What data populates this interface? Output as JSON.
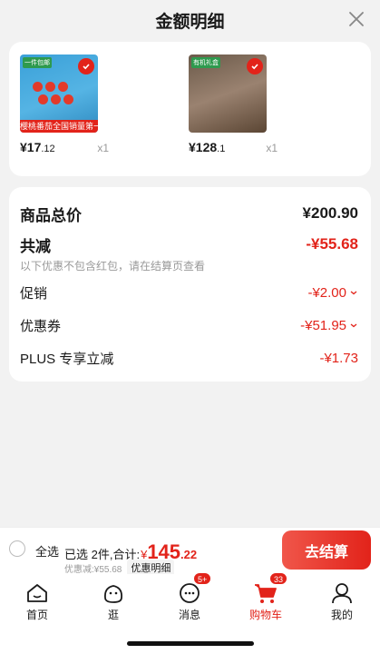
{
  "header": {
    "title": "金额明细"
  },
  "products": [
    {
      "price_int": "¥17",
      "price_dec": ".12",
      "qty": "x1",
      "badge": "樱桃番茄全国销量第一",
      "tag": "一件包邮"
    },
    {
      "price_int": "¥128",
      "price_dec": ".1",
      "qty": "x1",
      "badge": "",
      "tag": "有机礼盒"
    }
  ],
  "summary": {
    "total_label": "商品总价",
    "total_value": "¥200.90",
    "discount_label": "共减",
    "discount_value": "-¥55.68",
    "note": "以下优惠不包含红包，请在结算页查看",
    "items": [
      {
        "label": "促销",
        "value": "-¥2.00"
      },
      {
        "label": "优惠券",
        "value": "-¥51.95"
      },
      {
        "label": "PLUS 专享立减",
        "value": "-¥1.73"
      }
    ]
  },
  "checkout": {
    "select_all": "全选",
    "selected_text": "已选 2件,合计:",
    "currency": "¥",
    "sum_int": "145",
    "sum_dec": ".22",
    "discount_text": "优惠减:¥55.68",
    "detail_label": "优惠明细",
    "pay_label": "去结算"
  },
  "tabs": [
    {
      "label": "首页",
      "icon": "home-icon"
    },
    {
      "label": "逛",
      "icon": "explore-icon"
    },
    {
      "label": "消息",
      "icon": "message-icon",
      "badge": "5+"
    },
    {
      "label": "购物车",
      "icon": "cart-icon",
      "badge": "33",
      "active": true
    },
    {
      "label": "我的",
      "icon": "profile-icon"
    }
  ],
  "colors": {
    "accent": "#e2231a"
  }
}
